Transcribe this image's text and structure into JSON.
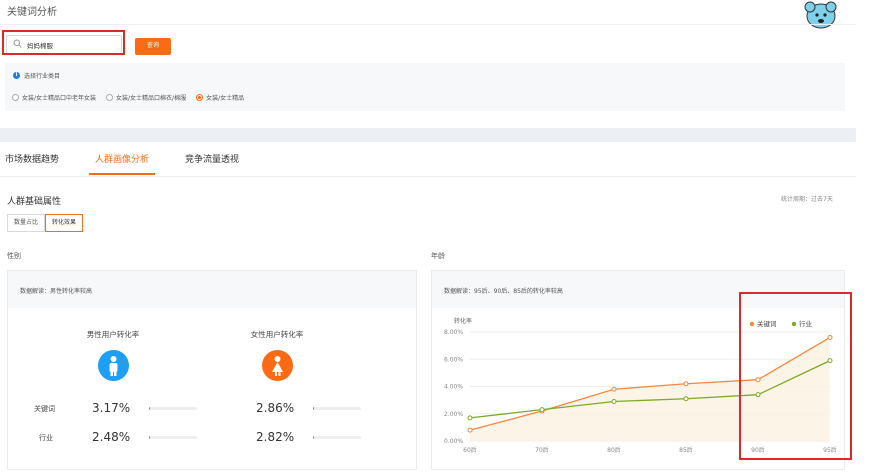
{
  "page_title": "关键词分析",
  "search": {
    "value": "妈妈棉服",
    "button_label": "查询"
  },
  "industry": {
    "label": "选择行业类目",
    "options": [
      {
        "label": "女装/女士精品口中老年女装",
        "selected": false
      },
      {
        "label": "女装/女士精品口棉衣/棉服",
        "selected": false
      },
      {
        "label": "女装/女士精品",
        "selected": true
      }
    ]
  },
  "tabs": [
    {
      "label": "市场数据趋势",
      "active": false
    },
    {
      "label": "人群画像分析",
      "active": true
    },
    {
      "label": "竞争流量透视",
      "active": false
    }
  ],
  "section_title": "人群基础属性",
  "period": "统计周期：过去7天",
  "toggle": [
    {
      "label": "数量占比",
      "active": false
    },
    {
      "label": "转化效果",
      "active": true
    }
  ],
  "gender": {
    "title": "性别",
    "note": "数据解读：男性转化率较高",
    "male_label": "男性用户转化率",
    "female_label": "女性用户转化率",
    "row_keyword": "关键词",
    "row_industry": "行业",
    "male_keyword": "3.17%",
    "male_industry": "2.48%",
    "female_keyword": "2.86%",
    "female_industry": "2.82%",
    "male_keyword_fill": 0.03,
    "male_industry_fill": 0.03,
    "female_keyword_fill": 0.03,
    "female_industry_fill": 0.03,
    "colors": {
      "male": "#1c9ff5",
      "female": "#fb6b15"
    }
  },
  "age": {
    "title": "年龄",
    "note": "数据解读：95后、90后、85后的转化率较高"
  },
  "chart_data": {
    "type": "line",
    "ylabel": "转化率",
    "categories": [
      "60后",
      "70后",
      "80后",
      "85后",
      "90后",
      "95后"
    ],
    "y_ticks": [
      "0.00%",
      "2.00%",
      "4.00%",
      "6.00%",
      "8.00%"
    ],
    "ylim": [
      0,
      8
    ],
    "legend_position": "top-right",
    "series": [
      {
        "name": "关键词",
        "color": "#f7883c",
        "values": [
          0.8,
          2.2,
          3.8,
          4.2,
          4.5,
          7.6
        ]
      },
      {
        "name": "行业",
        "color": "#7bab22",
        "values": [
          1.7,
          2.3,
          2.9,
          3.1,
          3.4,
          5.9
        ]
      }
    ],
    "grid": "horizontal"
  }
}
